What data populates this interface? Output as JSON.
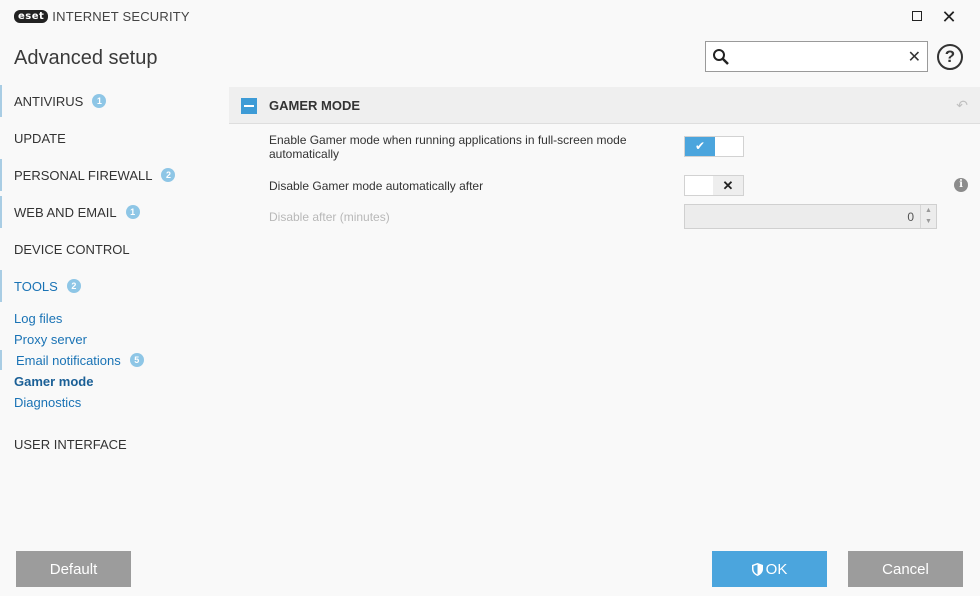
{
  "app": {
    "logo_badge": "eset",
    "logo_text": "INTERNET SECURITY",
    "maximize_icon": "maximize-icon",
    "close_icon": "close-icon"
  },
  "header": {
    "title": "Advanced setup",
    "search": {
      "value": "",
      "placeholder": ""
    },
    "help_label": "?"
  },
  "sidebar": {
    "items": [
      {
        "label": "ANTIVIRUS",
        "badge": "1"
      },
      {
        "label": "UPDATE",
        "badge": ""
      },
      {
        "label": "PERSONAL FIREWALL",
        "badge": "2"
      },
      {
        "label": "WEB AND EMAIL",
        "badge": "1"
      },
      {
        "label": "DEVICE CONTROL",
        "badge": ""
      },
      {
        "label": "TOOLS",
        "badge": "2"
      },
      {
        "label": "USER INTERFACE",
        "badge": ""
      }
    ],
    "tools_subitems": [
      {
        "label": "Log files",
        "badge": ""
      },
      {
        "label": "Proxy server",
        "badge": ""
      },
      {
        "label": "Email notifications",
        "badge": "5"
      },
      {
        "label": "Gamer mode",
        "badge": "",
        "active": true
      },
      {
        "label": "Diagnostics",
        "badge": ""
      }
    ]
  },
  "section": {
    "title": "GAMER MODE",
    "rows": [
      {
        "label_line1": "Enable Gamer mode when running applications in full-screen mode",
        "label_line2": "automatically",
        "enabled": true
      },
      {
        "label": "Disable Gamer mode automatically after",
        "enabled": false
      },
      {
        "label": "Disable after (minutes)",
        "value": "0",
        "disabled": true
      }
    ]
  },
  "footer": {
    "default_label": "Default",
    "ok_label": "OK",
    "cancel_label": "Cancel"
  },
  "colors": {
    "accent": "#4ba5dd",
    "badge": "#8ec6e6",
    "link": "#1a73b5",
    "button_gray": "#9c9c9c"
  }
}
